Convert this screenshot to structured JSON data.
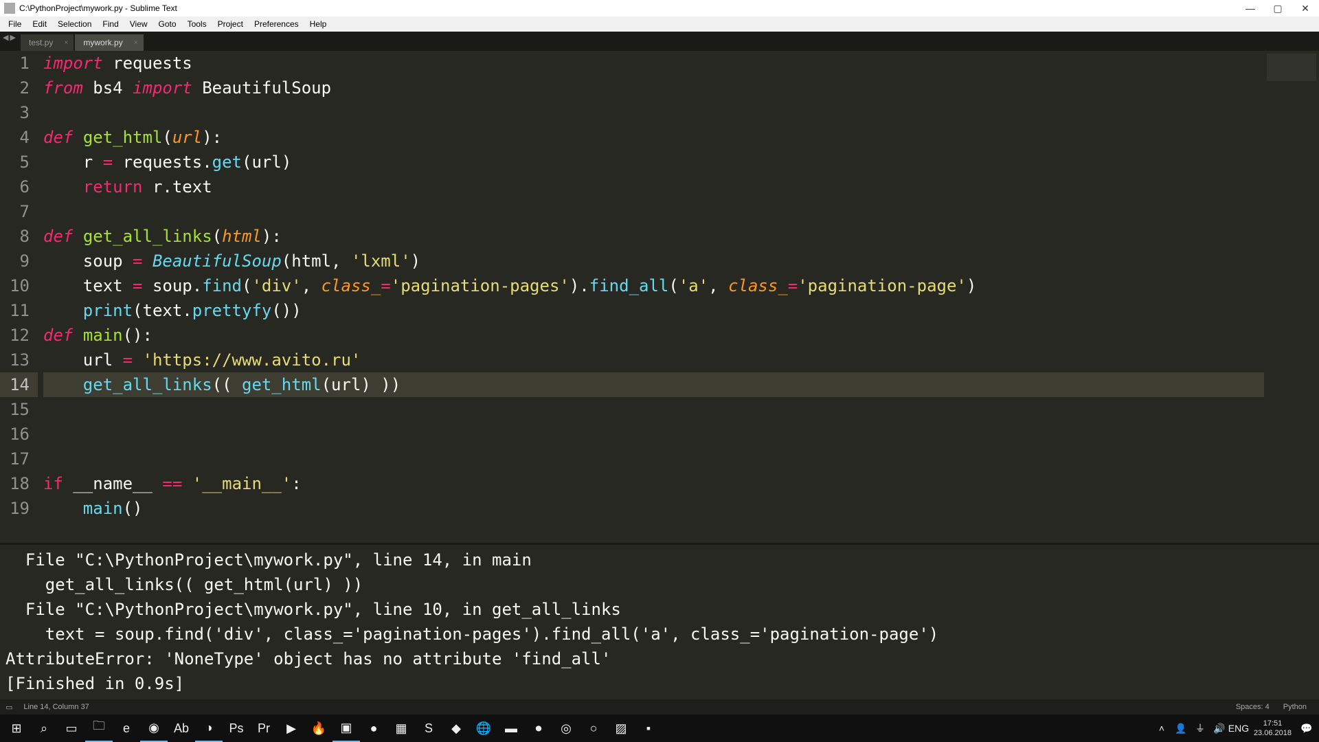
{
  "window": {
    "title": "C:\\PythonProject\\mywork.py - Sublime Text"
  },
  "menu": {
    "items": [
      "File",
      "Edit",
      "Selection",
      "Find",
      "View",
      "Goto",
      "Tools",
      "Project",
      "Preferences",
      "Help"
    ]
  },
  "tabs": {
    "list": [
      {
        "label": "test.py",
        "active": false
      },
      {
        "label": "mywork.py",
        "active": true
      }
    ]
  },
  "code": {
    "lines": [
      {
        "n": 1,
        "tokens": [
          [
            "k",
            "import"
          ],
          [
            "p",
            " requests"
          ]
        ]
      },
      {
        "n": 2,
        "tokens": [
          [
            "k",
            "from"
          ],
          [
            "p",
            " bs4 "
          ],
          [
            "k",
            "import"
          ],
          [
            "p",
            " BeautifulSoup"
          ]
        ]
      },
      {
        "n": 3,
        "tokens": [
          [
            "p",
            ""
          ]
        ]
      },
      {
        "n": 4,
        "tokens": [
          [
            "k",
            "def"
          ],
          [
            "p",
            " "
          ],
          [
            "fn",
            "get_html"
          ],
          [
            "p",
            "("
          ],
          [
            "param",
            "url"
          ],
          [
            "p",
            "):"
          ]
        ]
      },
      {
        "n": 5,
        "tokens": [
          [
            "p",
            "    r "
          ],
          [
            "op",
            "="
          ],
          [
            "p",
            " requests."
          ],
          [
            "call",
            "get"
          ],
          [
            "p",
            "(url)"
          ]
        ]
      },
      {
        "n": 6,
        "tokens": [
          [
            "p",
            "    "
          ],
          [
            "kw",
            "return"
          ],
          [
            "p",
            " r.text"
          ]
        ]
      },
      {
        "n": 7,
        "tokens": [
          [
            "p",
            ""
          ]
        ]
      },
      {
        "n": 8,
        "tokens": [
          [
            "k",
            "def"
          ],
          [
            "p",
            " "
          ],
          [
            "fn",
            "get_all_links"
          ],
          [
            "p",
            "("
          ],
          [
            "param",
            "html"
          ],
          [
            "p",
            "):"
          ]
        ]
      },
      {
        "n": 9,
        "tokens": [
          [
            "p",
            "    soup "
          ],
          [
            "op",
            "="
          ],
          [
            "p",
            " "
          ],
          [
            "cls",
            "BeautifulSoup"
          ],
          [
            "p",
            "(html, "
          ],
          [
            "str",
            "'lxml'"
          ],
          [
            "p",
            ")"
          ]
        ]
      },
      {
        "n": 10,
        "tokens": [
          [
            "p",
            "    text "
          ],
          [
            "op",
            "="
          ],
          [
            "p",
            " soup."
          ],
          [
            "call",
            "find"
          ],
          [
            "p",
            "("
          ],
          [
            "str",
            "'div'"
          ],
          [
            "p",
            ", "
          ],
          [
            "param",
            "class_"
          ],
          [
            "op",
            "="
          ],
          [
            "str",
            "'pagination-pages'"
          ],
          [
            "p",
            ")."
          ],
          [
            "call",
            "find_all"
          ],
          [
            "p",
            "("
          ],
          [
            "str",
            "'a'"
          ],
          [
            "p",
            ", "
          ],
          [
            "param",
            "class_"
          ],
          [
            "op",
            "="
          ],
          [
            "str",
            "'pagination-page'"
          ],
          [
            "p",
            ")"
          ]
        ]
      },
      {
        "n": 11,
        "tokens": [
          [
            "p",
            "    "
          ],
          [
            "call",
            "print"
          ],
          [
            "p",
            "(text."
          ],
          [
            "call",
            "prettyfy"
          ],
          [
            "p",
            "())"
          ]
        ]
      },
      {
        "n": 12,
        "tokens": [
          [
            "k",
            "def"
          ],
          [
            "p",
            " "
          ],
          [
            "fn",
            "main"
          ],
          [
            "p",
            "():"
          ]
        ]
      },
      {
        "n": 13,
        "tokens": [
          [
            "p",
            "    url "
          ],
          [
            "op",
            "="
          ],
          [
            "p",
            " "
          ],
          [
            "str",
            "'https://www.avito.ru'"
          ]
        ]
      },
      {
        "n": 14,
        "active": true,
        "tokens": [
          [
            "p",
            "    "
          ],
          [
            "call",
            "get_all_links"
          ],
          [
            "p",
            "(( "
          ],
          [
            "call",
            "get_html"
          ],
          [
            "p",
            "(url) ))"
          ]
        ]
      },
      {
        "n": 15,
        "tokens": [
          [
            "p",
            ""
          ]
        ]
      },
      {
        "n": 16,
        "tokens": [
          [
            "p",
            ""
          ]
        ]
      },
      {
        "n": 17,
        "tokens": [
          [
            "p",
            ""
          ]
        ]
      },
      {
        "n": 18,
        "tokens": [
          [
            "kw",
            "if"
          ],
          [
            "p",
            " __name__ "
          ],
          [
            "op",
            "=="
          ],
          [
            "p",
            " "
          ],
          [
            "str",
            "'__main__'"
          ],
          [
            "p",
            ":"
          ]
        ]
      },
      {
        "n": 19,
        "tokens": [
          [
            "p",
            "    "
          ],
          [
            "call",
            "main"
          ],
          [
            "p",
            "()"
          ]
        ]
      }
    ]
  },
  "console": {
    "lines": [
      "  File \"C:\\PythonProject\\mywork.py\", line 14, in main",
      "    get_all_links(( get_html(url) ))",
      "  File \"C:\\PythonProject\\mywork.py\", line 10, in get_all_links",
      "    text = soup.find('div', class_='pagination-pages').find_all('a', class_='pagination-page')",
      "AttributeError: 'NoneType' object has no attribute 'find_all'",
      "[Finished in 0.9s]"
    ]
  },
  "statusbar": {
    "left": "Line 14, Column 37",
    "spaces": "Spaces: 4",
    "syntax": "Python"
  },
  "taskbar": {
    "icons": [
      {
        "name": "start-icon",
        "glyph": "⊞"
      },
      {
        "name": "search-icon",
        "glyph": "⌕"
      },
      {
        "name": "taskview-icon",
        "glyph": "▭"
      },
      {
        "name": "explorer-icon",
        "glyph": "🗀",
        "running": true
      },
      {
        "name": "edge-icon",
        "glyph": "e"
      },
      {
        "name": "chrome-icon",
        "glyph": "◉",
        "running": true
      },
      {
        "name": "app-icon-1",
        "glyph": "Ab"
      },
      {
        "name": "steam-icon",
        "glyph": "◑",
        "running": true
      },
      {
        "name": "photoshop-icon",
        "glyph": "Ps"
      },
      {
        "name": "premiere-icon",
        "glyph": "Pr"
      },
      {
        "name": "media-icon",
        "glyph": "▶"
      },
      {
        "name": "flame-icon",
        "glyph": "🔥"
      },
      {
        "name": "sublime-icon",
        "glyph": "▣",
        "running": true
      },
      {
        "name": "color-icon",
        "glyph": "●"
      },
      {
        "name": "app-icon-2",
        "glyph": "▦"
      },
      {
        "name": "skype-icon",
        "glyph": "S"
      },
      {
        "name": "app-icon-3",
        "glyph": "◆"
      },
      {
        "name": "globe-icon",
        "glyph": "🌐"
      },
      {
        "name": "app-icon-4",
        "glyph": "▬"
      },
      {
        "name": "record-icon",
        "glyph": "⏺"
      },
      {
        "name": "obs-icon",
        "glyph": "◎"
      },
      {
        "name": "app-icon-5",
        "glyph": "○"
      },
      {
        "name": "app-icon-6",
        "glyph": "▨"
      },
      {
        "name": "terminal-icon",
        "glyph": "▪"
      }
    ],
    "tray": {
      "time": "17:51",
      "date": "23.06.2018",
      "lang": "ENG"
    }
  }
}
